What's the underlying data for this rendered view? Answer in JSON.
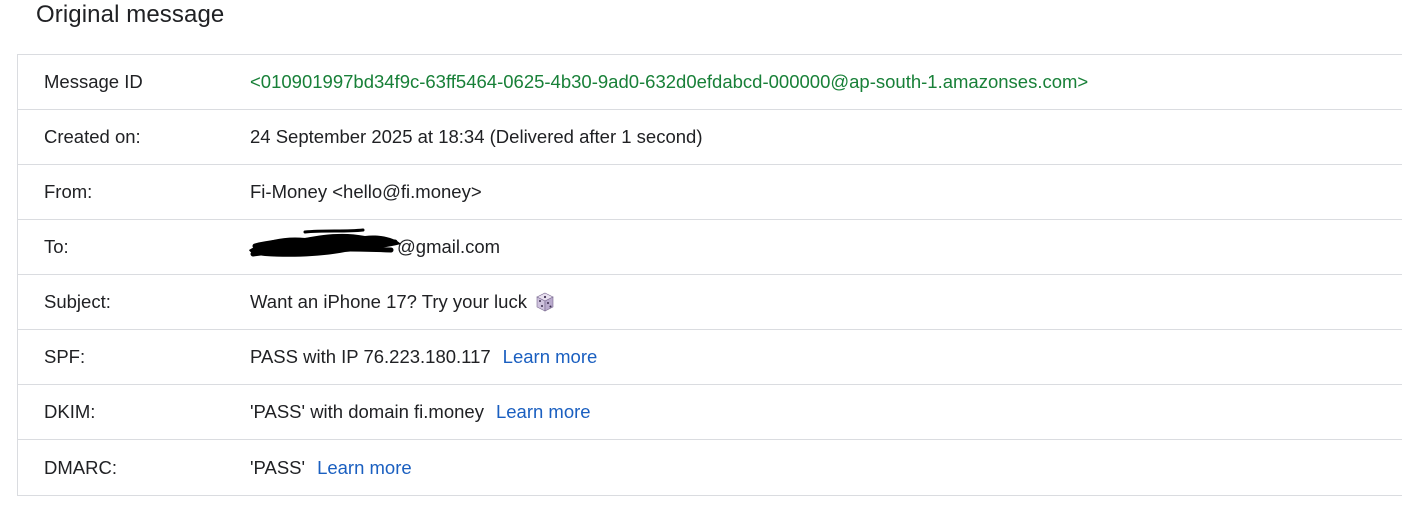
{
  "page": {
    "title": "Original message"
  },
  "rows": {
    "message_id": {
      "label": "Message ID",
      "value": "<010901997bd34f9c-63ff5464-0625-4b30-9ad0-632d0efdabcd-000000@ap-south-1.amazonses.com>"
    },
    "created_on": {
      "label": "Created on:",
      "value": "24 September 2025 at 18:34 (Delivered after 1 second)"
    },
    "from": {
      "label": "From:",
      "value": "Fi-Money <hello@fi.money>"
    },
    "to": {
      "label": "To:",
      "value_visible": "@gmail.com"
    },
    "subject": {
      "label": "Subject:",
      "value": "Want an iPhone 17? Try your luck",
      "emoji_icon": "dice-icon"
    },
    "spf": {
      "label": "SPF:",
      "value": "PASS with IP 76.223.180.117",
      "link": "Learn more"
    },
    "dkim": {
      "label": "DKIM:",
      "value": "'PASS' with domain fi.money",
      "link": "Learn more"
    },
    "dmarc": {
      "label": "DMARC:",
      "value": "'PASS'",
      "link": "Learn more"
    }
  },
  "colors": {
    "message_id_green": "#188038",
    "link_blue": "#1a5fc0",
    "border": "#dadce0",
    "text": "#202124"
  }
}
